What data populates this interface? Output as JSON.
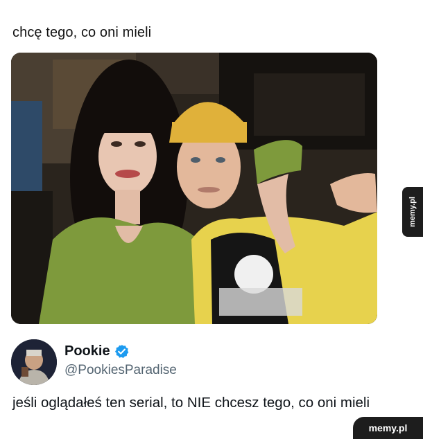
{
  "meme": {
    "caption": "chcę tego, co oni mieli"
  },
  "photo": {
    "description_icon": "photo-image"
  },
  "tweet": {
    "display_name": "Pookie",
    "handle": "@PookiesParadise",
    "text": "jeśli oglądałeś ten serial, to NIE chcesz tego, co oni mieli",
    "verified_color": "#1d9bf0"
  },
  "watermark": {
    "side_tab": "memy.pl",
    "corner_logo": "memy.pl"
  }
}
